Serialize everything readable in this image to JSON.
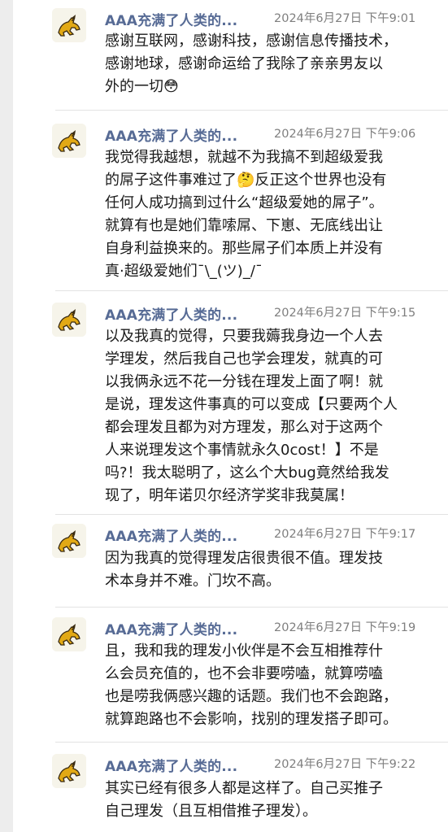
{
  "posts": [
    {
      "name": "AAA充满了人类的...",
      "time": "2024年6月27日 下午9:01",
      "text": "感谢互联网，感谢科技，感谢信息传播技术，\n感谢地球，感谢命运给了我除了亲亲男友以\n外的一切😳"
    },
    {
      "name": "AAA充满了人类的...",
      "time": "2024年6月27日 下午9:06",
      "text": "我觉得我越想，就越不为我搞不到超级爱我\n的屌子这件事难过了🤔反正这个世界也没有\n任何人成功搞到过什么“超级爱她的屌子”。\n就算有也是她们靠嗦屌、下崽、无底线出让\n自身利益换来的。那些屌子们本质上并没有\n真·超级爱她们¯\\_(ツ)_/¯"
    },
    {
      "name": "AAA充满了人类的...",
      "time": "2024年6月27日 下午9:15",
      "text": "以及我真的觉得，只要我薅我身边一个人去\n学理发，然后我自己也学会理发，就真的可\n以我俩永远不花一分钱在理发上面了啊！就\n是说，理发这件事真的可以变成【只要两个人\n都会理发且都为对方理发，那么对于这两个\n人来说理发这个事情就永久0cost！】不是\n吗?！我太聪明了，这么个大bug竟然给我发\n现了，明年诺贝尔经济学奖非我莫属！"
    },
    {
      "name": "AAA充满了人类的...",
      "time": "2024年6月27日 下午9:17",
      "text": "因为我真的觉得理发店很贵很不值。理发技\n术本身并不难。门坎不高。"
    },
    {
      "name": "AAA充满了人类的...",
      "time": "2024年6月27日 下午9:19",
      "text": "且，我和我的理发小伙伴是不会互相推荐什\n么会员充值的，也不会非要唠嗑，就算唠嗑\n也是唠我俩感兴趣的话题。我们也不会跑路，\n就算跑路也不会影响，找别的理发搭子即可。"
    },
    {
      "name": "AAA充满了人类的...",
      "time": "2024年6月27日 下午9:22",
      "text": "其实已经有很多人都是这样了。自己买推子\n自己理发（且互相借推子理发）。"
    }
  ]
}
